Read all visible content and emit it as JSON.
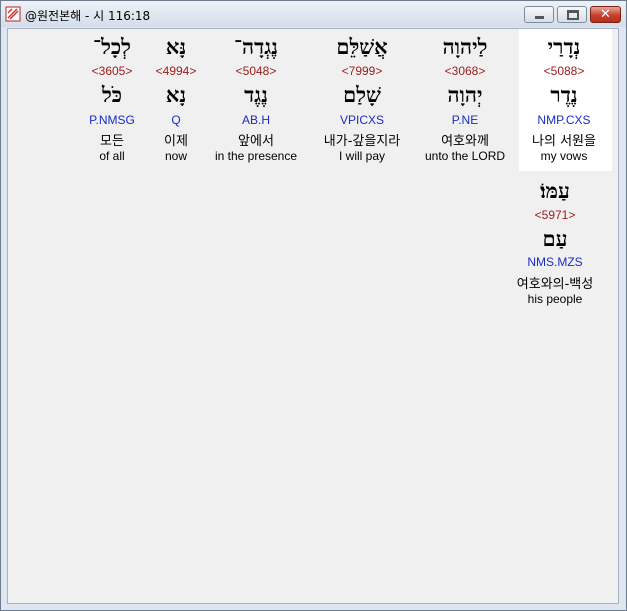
{
  "window": {
    "title": "@원전본해 - 시 116:18"
  },
  "words": [
    {
      "hebrew": "נְדָרַי",
      "strong": "<5088>",
      "lemma": "נֶדֶר",
      "morph": "NMP.CXS",
      "korean": "나의 서원을",
      "english": "my vows"
    },
    {
      "hebrew": "לַיהוָה",
      "strong": "<3068>",
      "lemma": "יְהוָה",
      "morph": "P.NE",
      "korean": "여호와께",
      "english": "unto the LORD"
    },
    {
      "hebrew": "אֲשַׁלֵּם",
      "strong": "<7999>",
      "lemma": "שָׁלַם",
      "morph": "VPICXS",
      "korean": "내가-갚을지라",
      "english": "I will pay"
    },
    {
      "hebrew": "נֶגְדָה־",
      "strong": "<5048>",
      "lemma": "נֶגֶד",
      "morph": "AB.H",
      "korean": "앞에서",
      "english": "in the presence"
    },
    {
      "hebrew": "נָּא",
      "strong": "<4994>",
      "lemma": "נָא",
      "morph": "Q",
      "korean": "이제",
      "english": "now"
    },
    {
      "hebrew": "לְכָל־",
      "strong": "<3605>",
      "lemma": "כֹּל",
      "morph": "P.NMSG",
      "korean": "모든",
      "english": "of all"
    },
    {
      "hebrew": "עַמּוֹ׃",
      "strong": "<5971>",
      "lemma": "עַם",
      "morph": "NMS.MZS",
      "korean": "여호와의-백성",
      "english": "his people"
    }
  ]
}
